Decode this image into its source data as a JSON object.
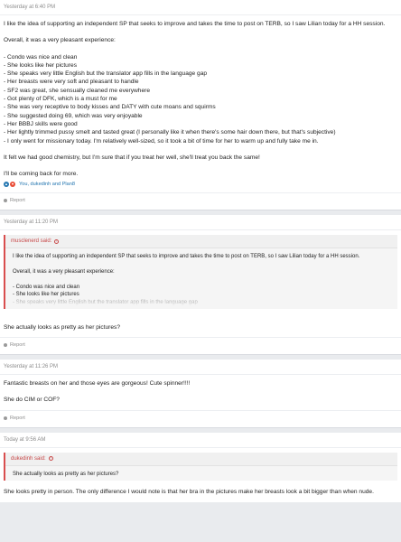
{
  "posts": [
    {
      "date": "Yesterday at 6:40 PM",
      "paragraphs": [
        [
          "I like the idea of supporting an independent SP that seeks to improve and takes the time to post on TERB, so I saw Lilian today for a HH session."
        ],
        [
          "Overall, it was a very pleasant experience:"
        ],
        [
          "- Condo was nice and clean",
          "- She looks like her pictures",
          "- She speaks very little English but the translator app fills in the language gap",
          "- Her breasts were very soft and pleasant to handle",
          "- SF2 was great, she sensually cleaned me everywhere",
          "- Got plenty of DFK, which is a must for me",
          "- She was very receptive to body kisses and DATY with cute moans and squirms",
          "- She suggested doing 69, which was very enjoyable",
          "- Her BBBJ skills were good",
          "- Her lightly trimmed pussy smelt and tasted great (I personally like it when there's some hair down there, but that's subjective)",
          "- I only went for missionary today. I'm relatively well-sized, so it took a bit of time for her to warm up and fully take me in."
        ],
        [
          "It felt we had good chemistry, but I'm sure that if you treat her well, she'll treat you back the same!"
        ],
        [
          "I'll be coming back for more."
        ]
      ],
      "reactions": "You, dukedinh and Plan8",
      "report": "Report"
    },
    {
      "date": "Yesterday at 11:20 PM",
      "quote": {
        "author": "musclenerd said:",
        "lines": [
          "I like the idea of supporting an independent SP that seeks to improve and takes the time to post on TERB, so I saw Lilian today for a HH session.",
          "",
          "Overall, it was a very pleasant experience:",
          "",
          "- Condo was nice and clean",
          "- She looks like her pictures"
        ],
        "faded": "- She speaks very little English but the translator app fills in the language gap"
      },
      "text": "She actually looks as pretty as her pictures?",
      "report": "Report"
    },
    {
      "date": "Yesterday at 11:26 PM",
      "lines": [
        "Fantastic breasts on her and those eyes are gorgeous! Cute spinner!!!!",
        "",
        "She do CIM or COF?"
      ],
      "report": "Report"
    },
    {
      "date": "Today at 9:56 AM",
      "quote": {
        "author": "dukedinh said:",
        "lines": [
          "She actually looks as pretty as her pictures?"
        ]
      },
      "text": "She looks pretty in person. The only difference I would note is that her bra in the pictures make her breasts look a bit bigger than when nude."
    }
  ],
  "colors": {
    "accent_blue": "#2577b1",
    "quote_red": "#c74848",
    "love_red": "#e94b35",
    "meta_gray": "#8c8c8c"
  },
  "icons": {
    "like": "thumbs-up-icon",
    "love": "heart-icon",
    "report": "report-icon",
    "quote_jump": "arrow-up-circle-icon"
  }
}
